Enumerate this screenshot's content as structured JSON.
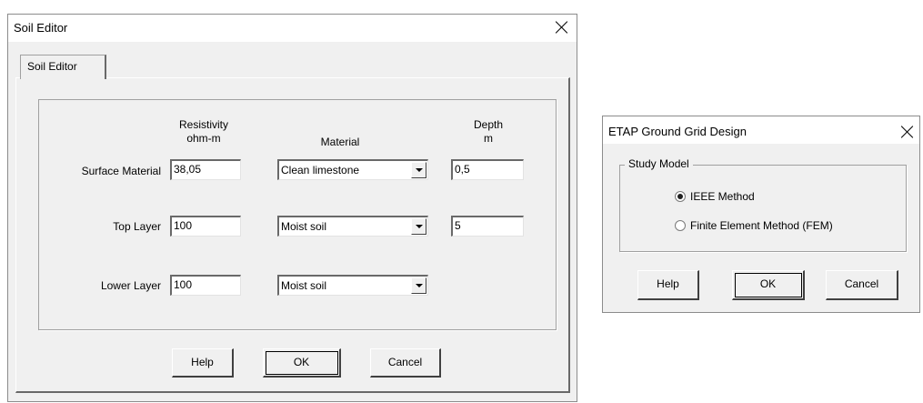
{
  "soil_editor": {
    "title": "Soil Editor",
    "tab_label": "Soil Editor",
    "headers": {
      "resistivity": "Resistivity",
      "resistivity_unit": "ohm-m",
      "material": "Material",
      "depth": "Depth",
      "depth_unit": "m"
    },
    "rows": [
      {
        "label": "Surface Material",
        "resistivity": "38,05",
        "material": "Clean limestone",
        "depth": "0,5"
      },
      {
        "label": "Top Layer",
        "resistivity": "100",
        "material": "Moist soil",
        "depth": "5"
      },
      {
        "label": "Lower Layer",
        "resistivity": "100",
        "material": "Moist soil"
      }
    ],
    "buttons": {
      "help": "Help",
      "ok": "OK",
      "cancel": "Cancel"
    }
  },
  "ground_grid": {
    "title": "ETAP Ground Grid Design",
    "group_label": "Study Model",
    "options": [
      {
        "label": "IEEE Method",
        "selected": true
      },
      {
        "label": "Finite Element Method (FEM)",
        "selected": false
      }
    ],
    "buttons": {
      "help": "Help",
      "ok": "OK",
      "cancel": "Cancel"
    }
  }
}
